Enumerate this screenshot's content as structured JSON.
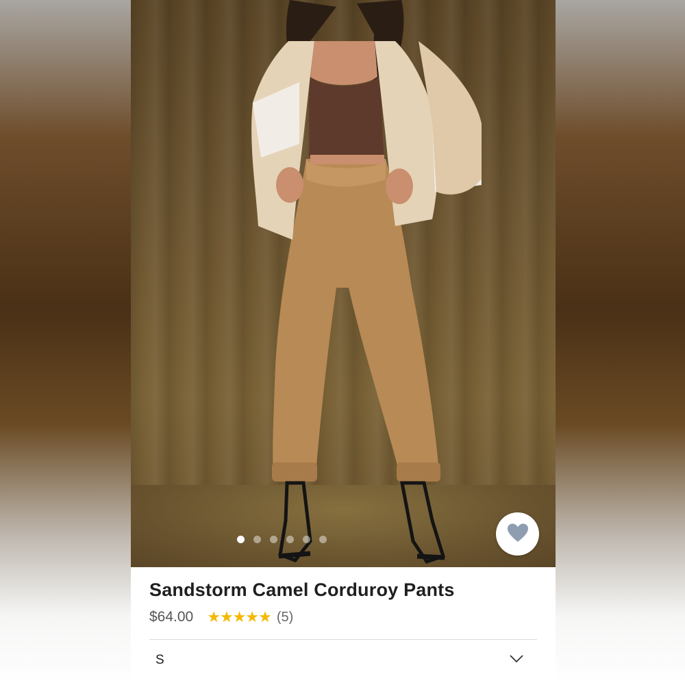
{
  "product": {
    "title": "Sandstorm Camel Corduroy Pants",
    "price": "$64.00",
    "rating_stars": "★★★★★",
    "rating_value": 5,
    "review_count": "(5)"
  },
  "gallery": {
    "image_count": 6,
    "active_index": 0
  },
  "size_selector": {
    "selected": "S"
  },
  "icons": {
    "favorite": "heart-icon",
    "dropdown": "chevron-down-icon"
  },
  "colors": {
    "star": "#f5b800",
    "heart": "#8e9db0",
    "title": "#1f1f1f",
    "price": "#555555"
  }
}
